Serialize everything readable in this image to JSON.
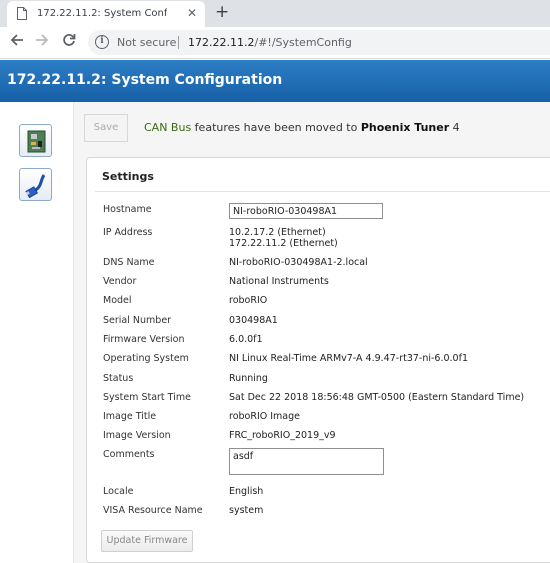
{
  "browser": {
    "tab_title": "172.22.11.2: System Configuration",
    "tab_close": "✕",
    "new_tab": "+",
    "security_label": "Not secure",
    "url_host": "172.22.11.2",
    "url_path": "/#!/SystemConfig"
  },
  "header": {
    "title": "172.22.11.2: System Configuration"
  },
  "toolbar": {
    "save_label": "Save",
    "notice_can": "CAN Bus",
    "notice_middle": " features have been moved to ",
    "notice_tuner": "Phoenix Tuner",
    "notice_version": " 4"
  },
  "settings": {
    "title": "Settings",
    "hostname_label": "Hostname",
    "hostname_value": "NI-roboRIO-030498A1",
    "ip_label": "IP Address",
    "ip_line1": "10.2.17.2 (Ethernet)",
    "ip_line2": "172.22.11.2 (Ethernet)",
    "dns_label": "DNS Name",
    "dns_value": "NI-roboRIO-030498A1-2.local",
    "vendor_label": "Vendor",
    "vendor_value": "National Instruments",
    "model_label": "Model",
    "model_value": "roboRIO",
    "serial_label": "Serial Number",
    "serial_value": "030498A1",
    "firmware_label": "Firmware Version",
    "firmware_value": "6.0.0f1",
    "os_label": "Operating System",
    "os_value": "NI Linux Real-Time ARMv7-A 4.9.47-rt37-ni-6.0.0f1",
    "status_label": "Status",
    "status_value": "Running",
    "start_label": "System Start Time",
    "start_value": "Sat Dec 22 2018 18:56:48 GMT-0500 (Eastern Standard Time)",
    "image_title_label": "Image Title",
    "image_title_value": "roboRIO Image",
    "image_version_label": "Image Version",
    "image_version_value": "FRC_roboRIO_2019_v9",
    "comments_label": "Comments",
    "comments_value": "asdf",
    "locale_label": "Locale",
    "locale_value": "English",
    "visa_label": "VISA Resource Name",
    "visa_value": "system",
    "update_label": "Update Firmware"
  },
  "icons": {
    "accent": "#1f6bb4",
    "can_color": "#3a6b14"
  }
}
